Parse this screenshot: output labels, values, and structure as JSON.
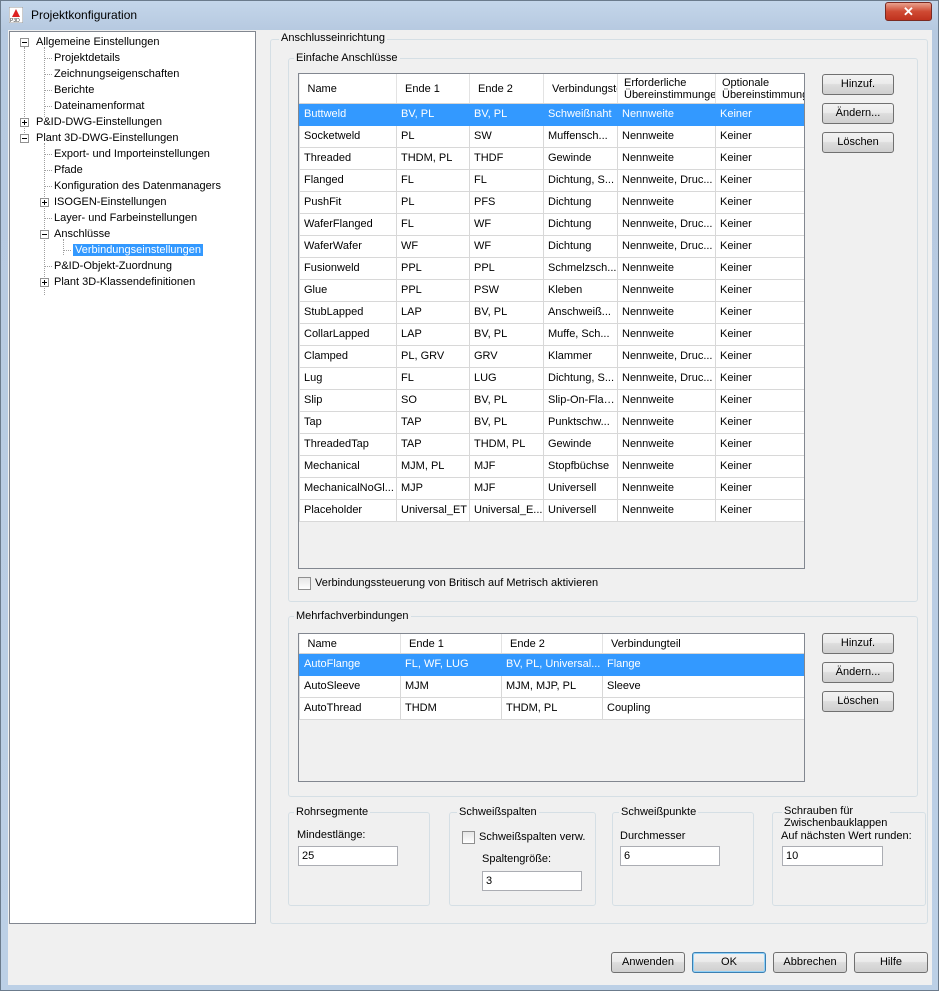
{
  "window": {
    "title": "Projektkonfiguration",
    "close_glyph": "✕",
    "app_icon": "autocad-plant3d-icon"
  },
  "tree": [
    {
      "label": "Allgemeine Einstellungen",
      "level": 0,
      "expander": "minus"
    },
    {
      "label": "Projektdetails",
      "level": 1
    },
    {
      "label": "Zeichnungseigenschaften",
      "level": 1
    },
    {
      "label": "Berichte",
      "level": 1
    },
    {
      "label": "Dateinamenformat",
      "level": 1
    },
    {
      "label": "P&ID-DWG-Einstellungen",
      "level": 0,
      "expander": "plus"
    },
    {
      "label": "Plant 3D-DWG-Einstellungen",
      "level": 0,
      "expander": "minus"
    },
    {
      "label": "Export- und Importeinstellungen",
      "level": 1
    },
    {
      "label": "Pfade",
      "level": 1
    },
    {
      "label": "Konfiguration des Datenmanagers",
      "level": 1
    },
    {
      "label": "ISOGEN-Einstellungen",
      "level": 1,
      "expander": "plus"
    },
    {
      "label": "Layer- und Farbeinstellungen",
      "level": 1
    },
    {
      "label": "Anschlüsse",
      "level": 1,
      "expander": "minus"
    },
    {
      "label": "Verbindungseinstellungen",
      "level": 2,
      "selected": true
    },
    {
      "label": "P&ID-Objekt-Zuordnung",
      "level": 1
    },
    {
      "label": "Plant 3D-Klassendefinitionen",
      "level": 1,
      "expander": "plus"
    }
  ],
  "panel_title": "Anschlusseinrichtung",
  "simple": {
    "title": "Einfache Anschlüsse",
    "columns": [
      "Name",
      "Ende 1",
      "Ende 2",
      "Verbindungsteil",
      "Erforderliche Übereinstimmungen",
      "Optionale Übereinstimmungen"
    ],
    "column_lines": [
      [
        "Name"
      ],
      [
        "Ende 1"
      ],
      [
        "Ende 2"
      ],
      [
        "Verbindungsteil"
      ],
      [
        "Erforderliche",
        "Übereinstimmungen"
      ],
      [
        "Optionale",
        "Übereinstimmungen"
      ]
    ],
    "rows": [
      [
        "Buttweld",
        "BV, PL",
        "BV, PL",
        "Schweißnaht",
        "Nennweite",
        "Keiner"
      ],
      [
        "Socketweld",
        "PL",
        "SW",
        "Muffensch...",
        "Nennweite",
        "Keiner"
      ],
      [
        "Threaded",
        "THDM, PL",
        "THDF",
        "Gewinde",
        "Nennweite",
        "Keiner"
      ],
      [
        "Flanged",
        "FL",
        "FL",
        "Dichtung, S...",
        "Nennweite, Druc...",
        "Keiner"
      ],
      [
        "PushFit",
        "PL",
        "PFS",
        "Dichtung",
        "Nennweite",
        "Keiner"
      ],
      [
        "WaferFlanged",
        "FL",
        "WF",
        "Dichtung",
        "Nennweite, Druc...",
        "Keiner"
      ],
      [
        "WaferWafer",
        "WF",
        "WF",
        "Dichtung",
        "Nennweite, Druc...",
        "Keiner"
      ],
      [
        "Fusionweld",
        "PPL",
        "PPL",
        "Schmelzsch...",
        "Nennweite",
        "Keiner"
      ],
      [
        "Glue",
        "PPL",
        "PSW",
        "Kleben",
        "Nennweite",
        "Keiner"
      ],
      [
        "StubLapped",
        "LAP",
        "BV, PL",
        "Anschweiß...",
        "Nennweite",
        "Keiner"
      ],
      [
        "CollarLapped",
        "LAP",
        "BV, PL",
        "Muffe, Sch...",
        "Nennweite",
        "Keiner"
      ],
      [
        "Clamped",
        "PL, GRV",
        "GRV",
        "Klammer",
        "Nennweite, Druc...",
        "Keiner"
      ],
      [
        "Lug",
        "FL",
        "LUG",
        "Dichtung, S...",
        "Nennweite, Druc...",
        "Keiner"
      ],
      [
        "Slip",
        "SO",
        "BV, PL",
        "Slip-On-Flan...",
        "Nennweite",
        "Keiner"
      ],
      [
        "Tap",
        "TAP",
        "BV, PL",
        "Punktschw...",
        "Nennweite",
        "Keiner"
      ],
      [
        "ThreadedTap",
        "TAP",
        "THDM, PL",
        "Gewinde",
        "Nennweite",
        "Keiner"
      ],
      [
        "Mechanical",
        "MJM, PL",
        "MJF",
        "Stopfbüchse",
        "Nennweite",
        "Keiner"
      ],
      [
        "MechanicalNoGl...",
        "MJP",
        "MJF",
        "Universell",
        "Nennweite",
        "Keiner"
      ],
      [
        "Placeholder",
        "Universal_ET",
        "Universal_E...",
        "Universell",
        "Nennweite",
        "Keiner"
      ]
    ],
    "selected_row": 0,
    "buttons": {
      "add": "Hinzuf.",
      "edit": "Ändern...",
      "delete": "Löschen"
    },
    "checkbox_label": "Verbindungssteuerung von Britisch auf Metrisch aktivieren"
  },
  "multi": {
    "title": "Mehrfachverbindungen",
    "columns": [
      "Name",
      "Ende 1",
      "Ende 2",
      "Verbindungteil"
    ],
    "rows": [
      [
        "AutoFlange",
        "FL, WF, LUG",
        "BV, PL, Universal...",
        "Flange"
      ],
      [
        "AutoSleeve",
        "MJM",
        "MJM, MJP, PL",
        "Sleeve"
      ],
      [
        "AutoThread",
        "THDM",
        "THDM, PL",
        "Coupling"
      ]
    ],
    "selected_row": 0,
    "buttons": {
      "add": "Hinzuf.",
      "edit": "Ändern...",
      "delete": "Löschen"
    }
  },
  "pipe_segments": {
    "title": "Rohrsegmente",
    "label": "Mindestlänge:",
    "value": "25"
  },
  "weld_gaps": {
    "title": "Schweißspalten",
    "checkbox_label": "Schweißspalten verw.",
    "label": "Spaltengröße:",
    "value": "3"
  },
  "weld_points": {
    "title": "Schweißpunkte",
    "label": "Durchmesser",
    "value": "6"
  },
  "wafer_bolts": {
    "title": "Schrauben für Zwischenbauklappen",
    "label": "Auf nächsten Wert runden:",
    "value": "10"
  },
  "footer": {
    "apply": "Anwenden",
    "ok": "OK",
    "cancel": "Abbrechen",
    "help": "Hilfe"
  }
}
